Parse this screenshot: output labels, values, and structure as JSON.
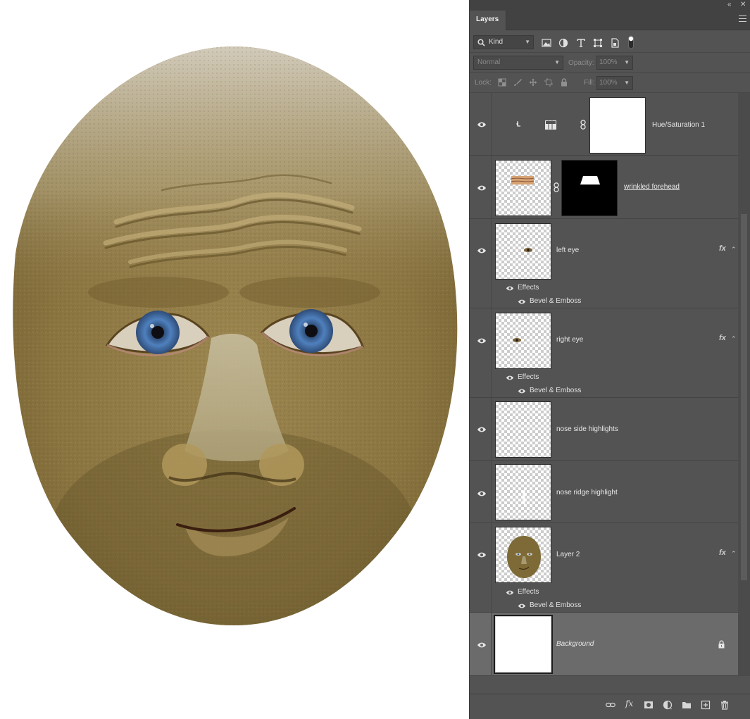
{
  "panel": {
    "tab_label": "Layers",
    "collapse_glyph": "«",
    "close_glyph": "✕",
    "menu_icon": "hamburger-menu-icon"
  },
  "filter": {
    "kind_label": "Kind",
    "icons": [
      "image-filter-icon",
      "adjustment-filter-icon",
      "type-filter-icon",
      "shape-filter-icon",
      "smart-object-filter-icon",
      "filter-toggle-icon"
    ]
  },
  "blend": {
    "mode": "Normal",
    "opacity_label": "Opacity:",
    "opacity_value": "100%"
  },
  "lock": {
    "label": "Lock:",
    "fill_label": "Fill:",
    "fill_value": "100%",
    "icons": [
      "lock-transparent-pixels-icon",
      "lock-image-pixels-icon",
      "lock-position-icon",
      "lock-artboard-icon",
      "lock-all-icon"
    ]
  },
  "layers": [
    {
      "name": "Hue/Saturation 1",
      "type": "adjustment",
      "visible": true
    },
    {
      "name": "wrinkled forehead",
      "type": "masked",
      "visible": true
    },
    {
      "name": "left eye",
      "type": "effects",
      "visible": true,
      "effects_label": "Effects",
      "effect": "Bevel & Emboss",
      "fx": "fx"
    },
    {
      "name": "right eye",
      "type": "effects",
      "visible": true,
      "effects_label": "Effects",
      "effect": "Bevel & Emboss",
      "fx": "fx"
    },
    {
      "name": "nose side highlights",
      "type": "plain",
      "visible": true
    },
    {
      "name": "nose ridge highlight",
      "type": "plain",
      "visible": true
    },
    {
      "name": "Layer 2",
      "type": "effects",
      "visible": true,
      "effects_label": "Effects",
      "effect": "Bevel & Emboss",
      "fx": "fx"
    },
    {
      "name": "Background",
      "type": "background",
      "visible": true,
      "locked": true,
      "selected": true
    }
  ],
  "bottom_toolbar": [
    "link-layers-icon",
    "layer-style-fx-icon",
    "add-mask-icon",
    "new-adjustment-layer-icon",
    "new-group-folder-icon",
    "new-layer-icon",
    "delete-layer-trash-icon"
  ],
  "bottom_fx_label": "fx",
  "colors": {
    "panel_bg": "#535353",
    "panel_dark": "#424242",
    "selected_row": "#6b6b6b",
    "skin": "#8a7440",
    "iris": "#4a7ab8"
  }
}
